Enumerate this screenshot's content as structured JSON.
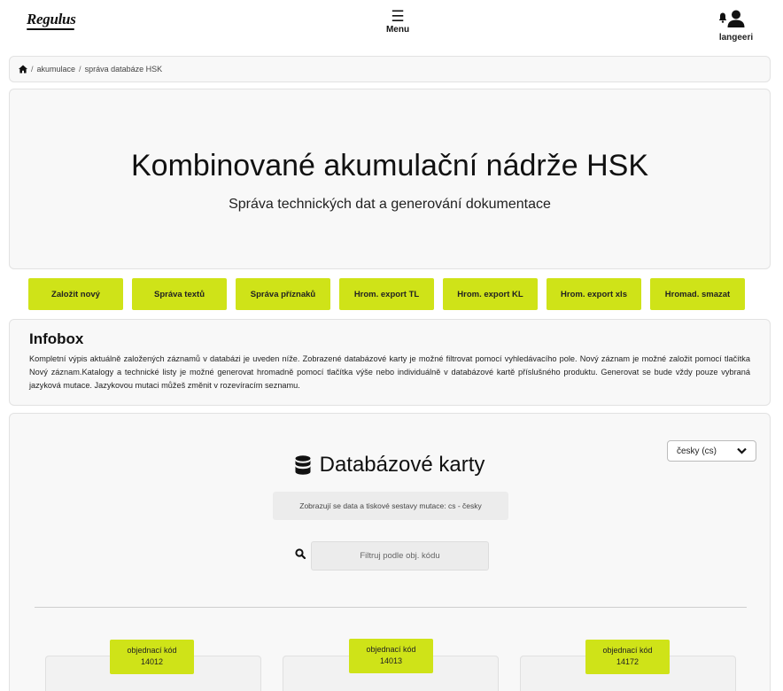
{
  "header": {
    "logo": "Regulus",
    "menu_label": "Menu",
    "username": "langeeri"
  },
  "breadcrumb": {
    "items": [
      "akumulace",
      "správa databáze HSK"
    ]
  },
  "hero": {
    "title": "Kombinované akumulační nádrže HSK",
    "subtitle": "Správa technických dat a generování dokumentace"
  },
  "actions": {
    "buttons": [
      "Založit nový",
      "Správa textů",
      "Správa příznaků",
      "Hrom. export TL",
      "Hrom. export KL",
      "Hrom. export xls",
      "Hromad. smazat"
    ]
  },
  "infobox": {
    "title": "Infobox",
    "text": "Kompletní výpis aktuálně založených záznamů v databázi je uveden níže. Zobrazené databázové karty je možné filtrovat pomocí vyhledávacího pole. Nový záznam je možné založit pomocí tlačítka Nový záznam.Katalogy a technické listy je možné generovat hromadně pomocí tlačítka výše nebo individuálně v databázové kartě příslušného produktu. Generovat se bude vždy pouze vybraná jazyková mutace. Jazykovou mutaci můžeš změnit v rozevíracím seznamu."
  },
  "database": {
    "title": "Databázové karty",
    "language_select": "česky (cs)",
    "mutation_note": "Zobrazují se data a tiskové sestavy mutace: cs - česky",
    "search_placeholder": "Filtruj podle obj. kódu",
    "cards": [
      {
        "label": "objednací kód",
        "code": "14012"
      },
      {
        "label": "objednací kód",
        "code": "14013"
      },
      {
        "label": "objednací kód",
        "code": "14172"
      }
    ]
  },
  "colors": {
    "accent": "#cfe318",
    "panel": "#f8f8f8"
  }
}
